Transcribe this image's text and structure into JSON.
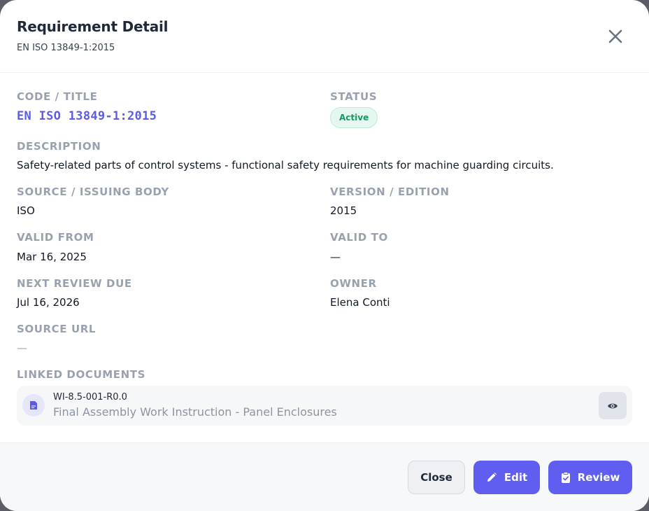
{
  "header": {
    "title": "Requirement Detail",
    "subtitle": "EN ISO 13849-1:2015"
  },
  "fields": {
    "code_title_label": "CODE / TITLE",
    "code_title_value": "EN ISO 13849-1:2015",
    "status_label": "STATUS",
    "status_value": "Active",
    "description_label": "DESCRIPTION",
    "description_value": "Safety-related parts of control systems - functional safety requirements for machine guarding circuits.",
    "source_label": "SOURCE / ISSUING BODY",
    "source_value": "ISO",
    "version_label": "VERSION / EDITION",
    "version_value": "2015",
    "valid_from_label": "VALID FROM",
    "valid_from_value": "Mar 16, 2025",
    "valid_to_label": "VALID TO",
    "valid_to_value": "—",
    "next_review_label": "NEXT REVIEW DUE",
    "next_review_value": "Jul 16, 2026",
    "owner_label": "OWNER",
    "owner_value": "Elena Conti",
    "source_url_label": "SOURCE URL",
    "source_url_value": "—"
  },
  "linked_documents": {
    "label": "LINKED DOCUMENTS",
    "items": [
      {
        "code": "WI-8.5-001-R0.0",
        "title": "Final Assembly Work Instruction - Panel Enclosures",
        "icon": "document-icon",
        "action_icon": "eye-icon"
      }
    ]
  },
  "footer": {
    "close_label": "Close",
    "edit_label": "Edit",
    "review_label": "Review"
  },
  "colors": {
    "accent": "#5f5ef0",
    "status_active": "#139b63",
    "label_gray": "#9aa1ae"
  }
}
